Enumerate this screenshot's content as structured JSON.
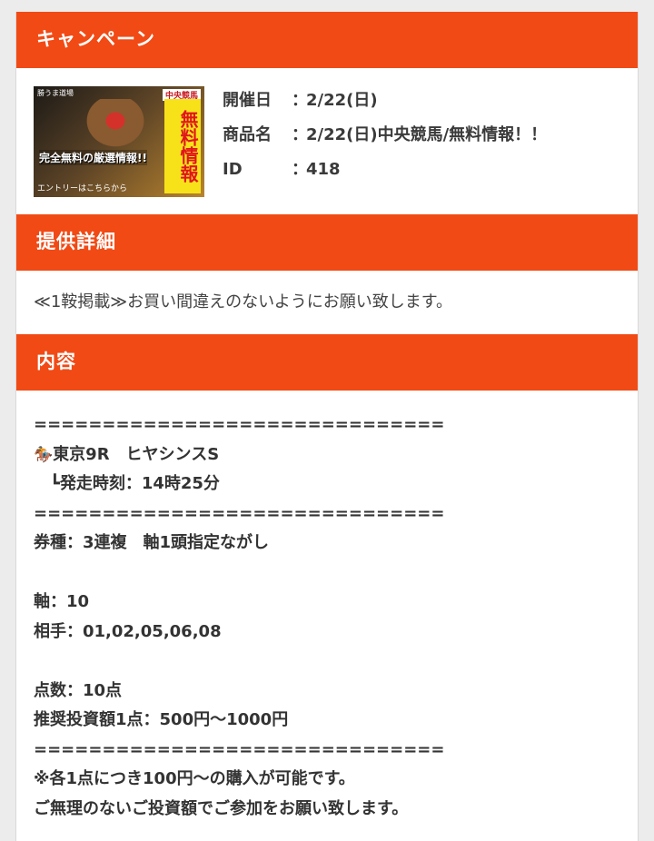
{
  "campaign": {
    "header": "キャンペーン",
    "banner": {
      "top_text": "勝うま道場",
      "tag": "中央競馬",
      "free_text": "無料情報",
      "mid_text": "完全無料の厳選情報!!",
      "bottom_text": "エントリーはこちらから"
    },
    "info": [
      {
        "label": "開催日",
        "colon": "：",
        "value": "2/22(日)"
      },
      {
        "label": "商品名",
        "colon": "：",
        "value": "2/22(日)中央競馬/無料情報！！"
      },
      {
        "label": "ID",
        "colon": "：",
        "value": "418"
      }
    ]
  },
  "details": {
    "header": "提供詳細",
    "text": "≪1鞍掲載≫お買い間違えのないようにお願い致します。"
  },
  "content": {
    "header": "内容",
    "separator": "==============================",
    "race_icon": "horse-racing-icon",
    "race_icon_glyph": "🏇",
    "race_name": "東京9R　ヒヤシンスS",
    "start_time": "　┗発走時刻：14時25分",
    "bet_type": "券種：3連複　軸1頭指定ながし",
    "axis": "軸：10",
    "partners": "相手：01,02,05,06,08",
    "points": "点数：10点",
    "recommended": "推奨投資額1点：500円〜1000円",
    "note1": "※各1点につき100円〜の購入が可能です。",
    "note2": "ご無理のないご投資額でご参加をお願い致します。"
  }
}
